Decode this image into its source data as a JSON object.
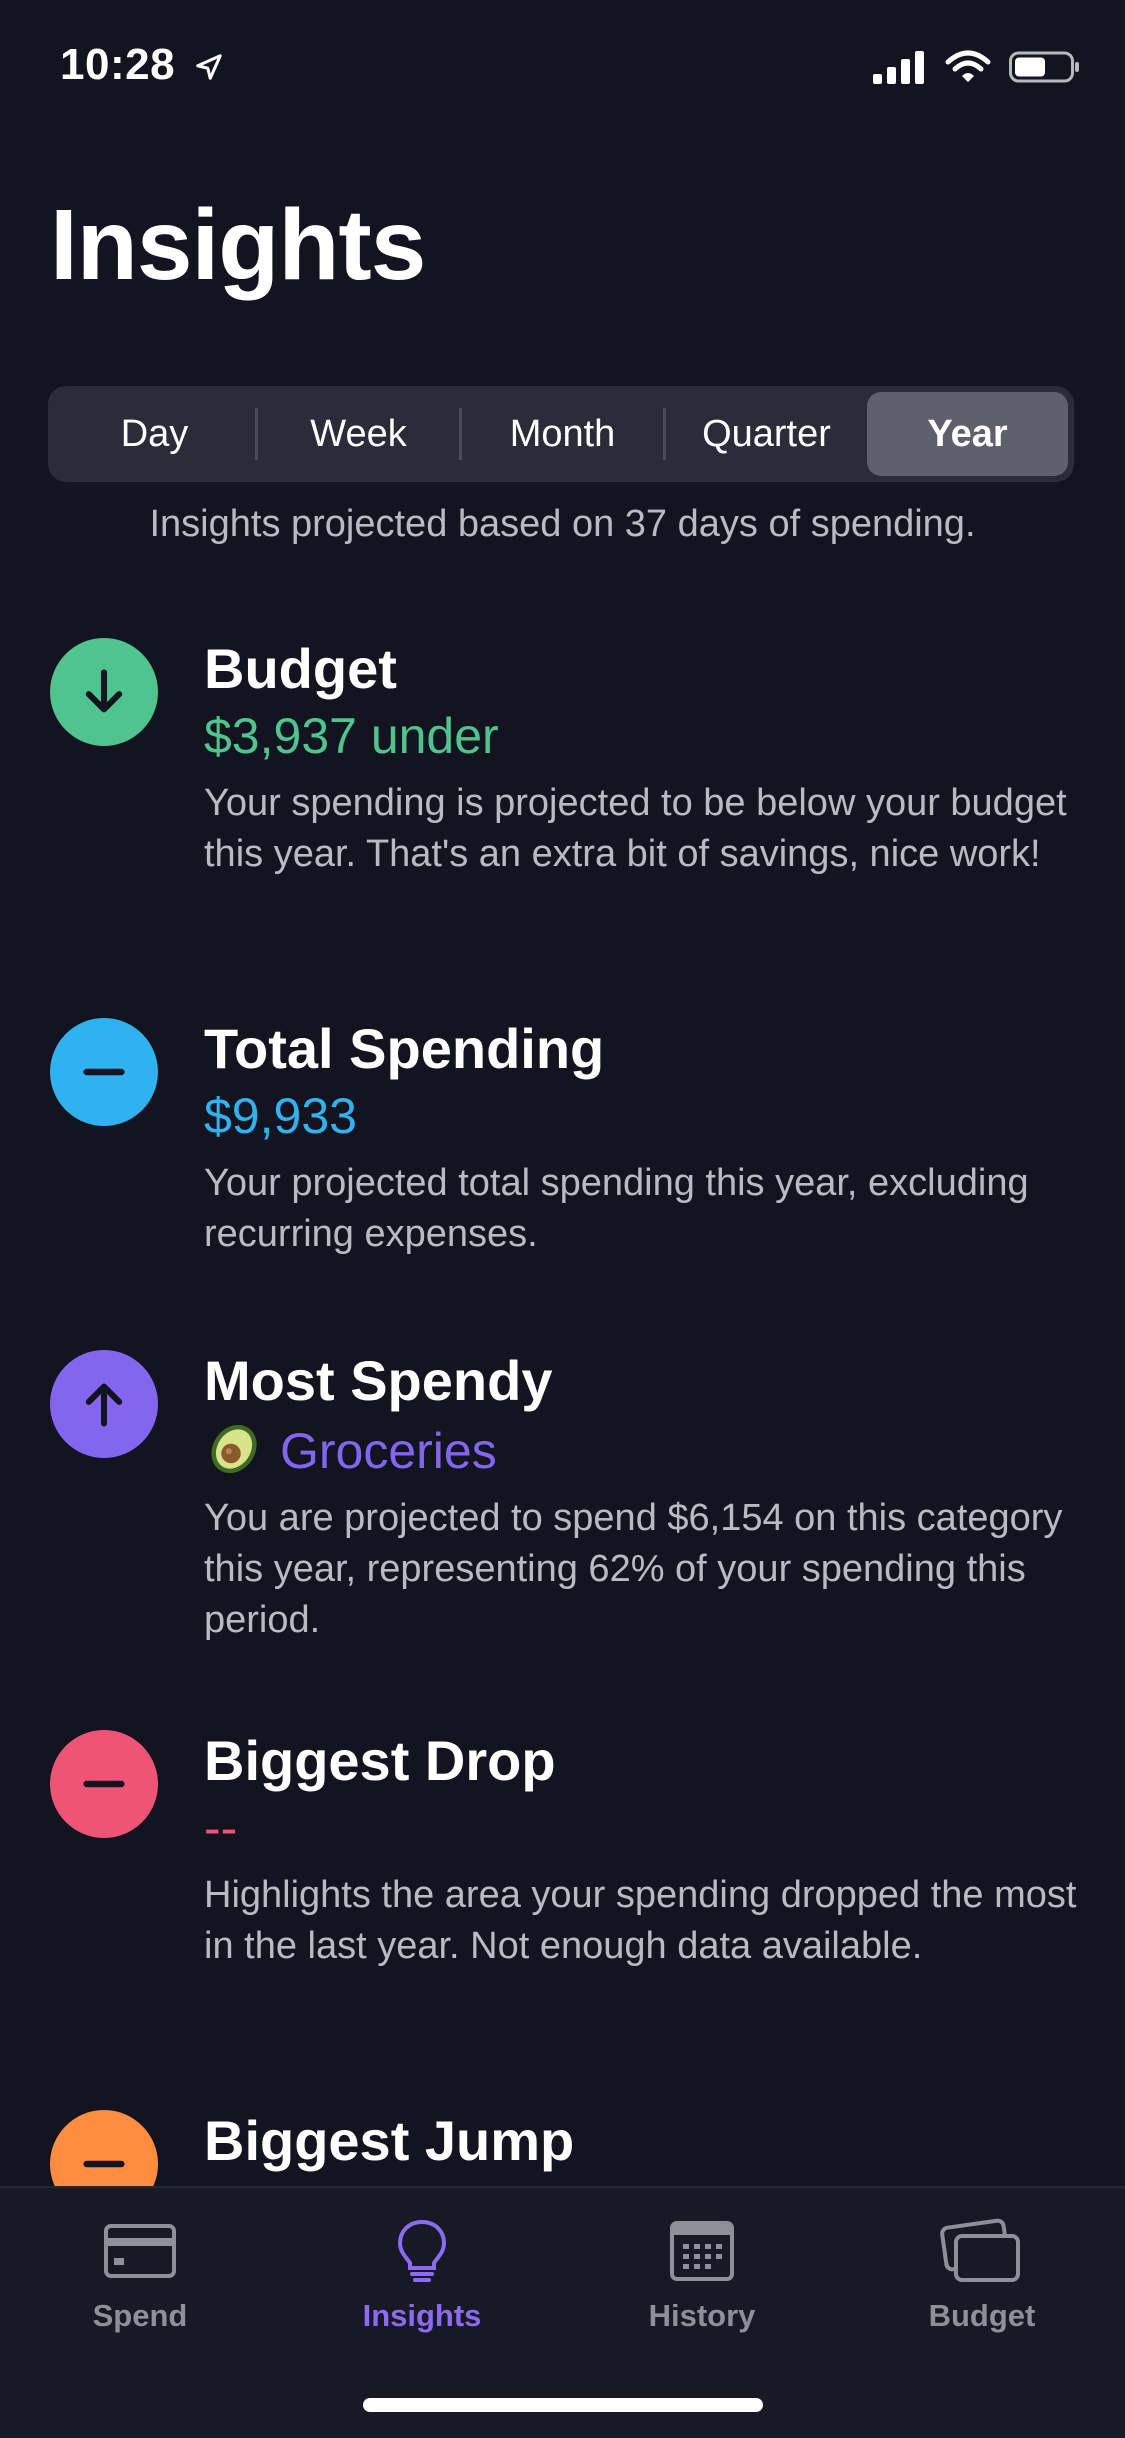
{
  "status_bar": {
    "time": "10:28"
  },
  "page": {
    "title": "Insights",
    "subtitle": "Insights projected based on 37 days of spending."
  },
  "segments": {
    "items": [
      {
        "label": "Day"
      },
      {
        "label": "Week"
      },
      {
        "label": "Month"
      },
      {
        "label": "Quarter"
      },
      {
        "label": "Year"
      }
    ],
    "selected": "Year"
  },
  "insights": [
    {
      "title": "Budget",
      "value": "$3,937 under",
      "description": "Your spending is projected to be below your budget this year. That's an extra bit of savings, nice work!",
      "icon": "arrow-down-icon",
      "color": "#4fc48e"
    },
    {
      "title": "Total Spending",
      "value": "$9,933",
      "description": "Your projected total spending this year, excluding recurring expenses.",
      "icon": "minus-icon",
      "color": "#2fb2ef"
    },
    {
      "title": "Most Spendy",
      "value": "Groceries",
      "value_emoji": "avocado-icon",
      "description": "You are projected to spend $6,154 on this category this year, representing 62% of your spending this period.",
      "icon": "arrow-up-icon",
      "color": "#8266f0"
    },
    {
      "title": "Biggest Drop",
      "value": "--",
      "description": "Highlights the area your spending dropped the most in the last year. Not enough data available.",
      "icon": "minus-icon",
      "color": "#ee5475"
    },
    {
      "title": "Biggest Jump",
      "icon": "minus-icon",
      "color": "#ff8d3f"
    }
  ],
  "tab_bar": {
    "items": [
      {
        "label": "Spend",
        "icon": "card-icon"
      },
      {
        "label": "Insights",
        "icon": "lightbulb-icon"
      },
      {
        "label": "History",
        "icon": "calendar-icon"
      },
      {
        "label": "Budget",
        "icon": "wallet-icon"
      }
    ],
    "active": "Insights",
    "active_color": "#8b6cf0"
  }
}
